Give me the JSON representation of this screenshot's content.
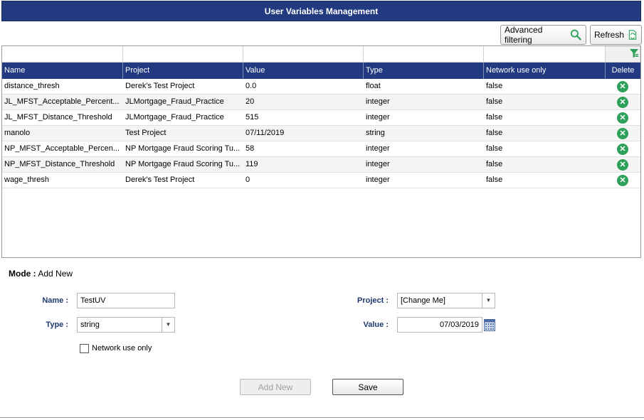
{
  "title": "User Variables Management",
  "toolbar": {
    "advanced_filtering": "Advanced filtering",
    "refresh": "Refresh"
  },
  "table": {
    "columns": [
      "Name",
      "Project",
      "Value",
      "Type",
      "Network use only",
      "Delete"
    ],
    "rows": [
      {
        "name": "distance_thresh",
        "project": "Derek's Test Project",
        "value": "0.0",
        "type": "float",
        "network": "false"
      },
      {
        "name": "JL_MFST_Acceptable_Percent...",
        "project": "JLMortgage_Fraud_Practice",
        "value": "20",
        "type": "integer",
        "network": "false"
      },
      {
        "name": "JL_MFST_Distance_Threshold",
        "project": "JLMortgage_Fraud_Practice",
        "value": "515",
        "type": "integer",
        "network": "false"
      },
      {
        "name": "manolo",
        "project": "Test Project",
        "value": "07/11/2019",
        "type": "string",
        "network": "false"
      },
      {
        "name": "NP_MFST_Acceptable_Percen...",
        "project": "NP Mortgage Fraud Scoring Tu...",
        "value": "58",
        "type": "integer",
        "network": "false"
      },
      {
        "name": "NP_MFST_Distance_Threshold",
        "project": "NP Mortgage Fraud Scoring Tu...",
        "value": "119",
        "type": "integer",
        "network": "false"
      },
      {
        "name": "wage_thresh",
        "project": "Derek's Test Project",
        "value": "0",
        "type": "integer",
        "network": "false"
      }
    ]
  },
  "form": {
    "mode_label": "Mode :",
    "mode_value": "Add New",
    "name_label": "Name :",
    "name_value": "TestUV",
    "type_label": "Type :",
    "type_value": "string",
    "network_label": "Network use only",
    "project_label": "Project :",
    "project_value": "[Change Me]",
    "value_label": "Value :",
    "value_value": "07/03/2019",
    "add_new_button": "Add New",
    "save_button": "Save"
  },
  "icons": {
    "search": "search-icon",
    "refresh": "refresh-icon",
    "filter": "filter-icon",
    "delete": "delete-icon",
    "calendar": "calendar-icon",
    "dropdown": "chevron-down-icon"
  },
  "colors": {
    "header_bg": "#213a80",
    "delete_green": "#2ea05a"
  }
}
